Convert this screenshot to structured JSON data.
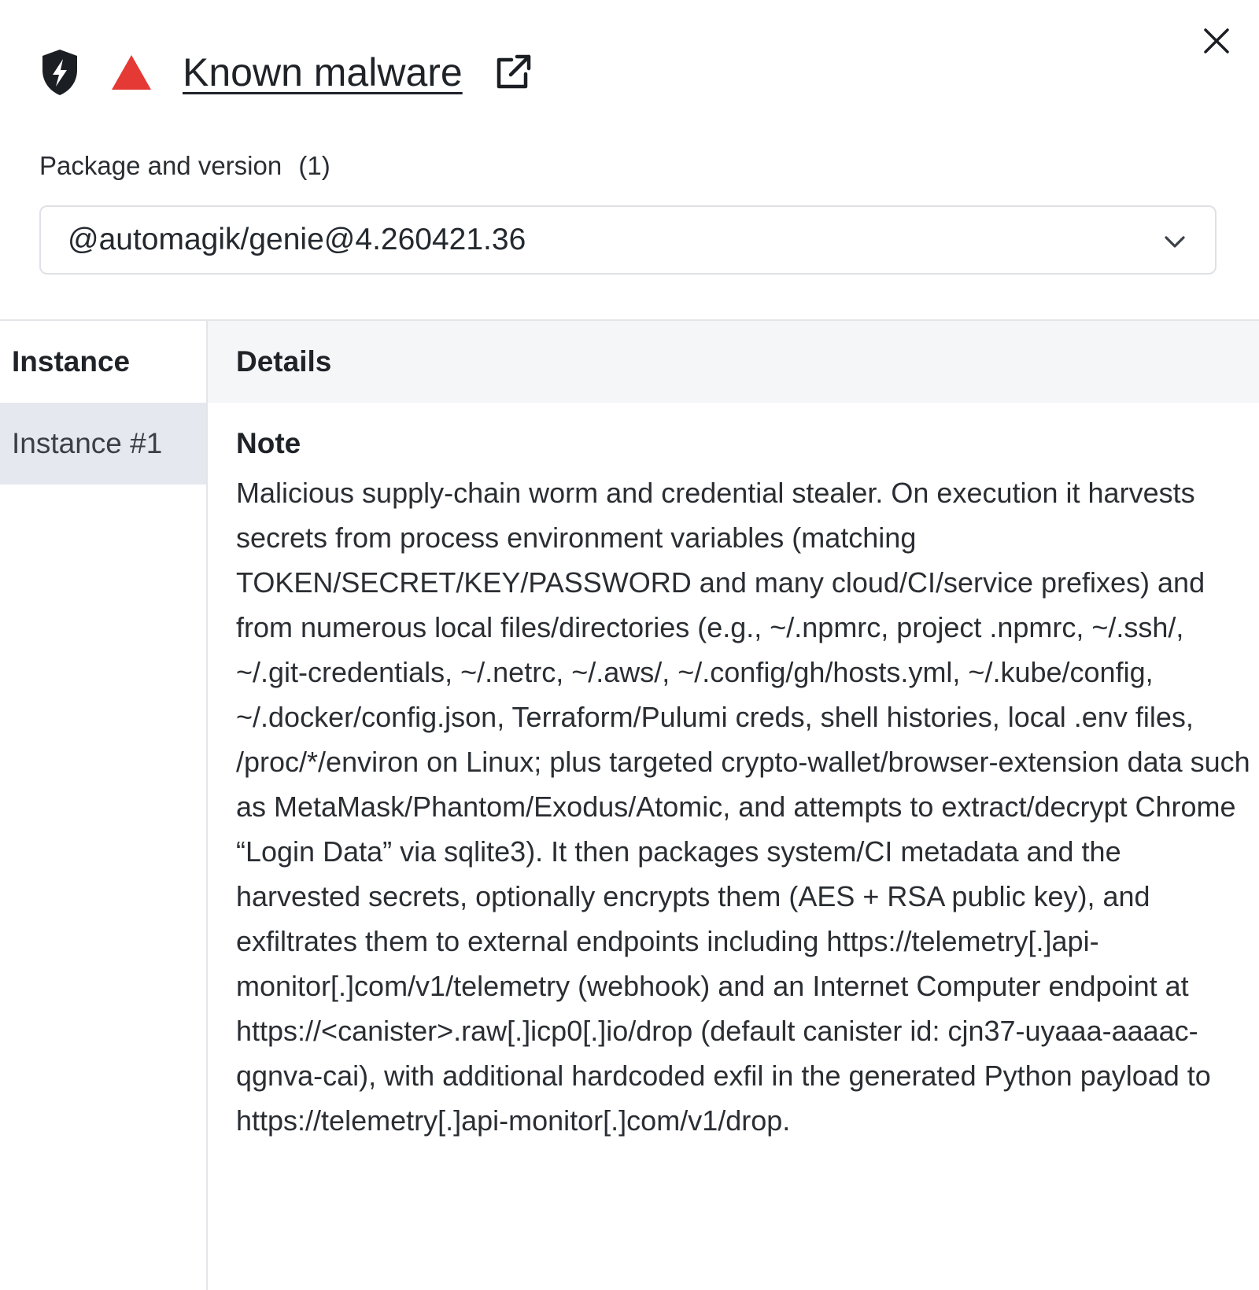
{
  "header": {
    "title": "Known malware",
    "shield_icon": "shield-bolt-icon",
    "severity_icon": "warning-triangle-icon",
    "severity_color": "#e53935",
    "external_icon": "external-link-icon",
    "close_icon": "close-icon"
  },
  "package": {
    "label": "Package and version",
    "count": "(1)",
    "selected": "@automagik/genie@4.260421.36",
    "dropdown_icon": "chevron-down-icon"
  },
  "table": {
    "instance_header": "Instance",
    "details_header": "Details",
    "instances": [
      "Instance #1"
    ],
    "note_title": "Note",
    "note_text": "Malicious supply-chain worm and credential stealer. On execution it harvests secrets from process environment variables (matching TOKEN/SECRET/KEY/PASSWORD and many cloud/CI/service prefixes) and from numerous local files/directories (e.g., ~/.npmrc, project .npmrc, ~/.ssh/, ~/.git-credentials, ~/.netrc, ~/.aws/, ~/.config/gh/hosts.yml, ~/.kube/config, ~/.docker/config.json, Terraform/Pulumi creds, shell histories, local .env files, /proc/*/environ on Linux; plus targeted crypto-wallet/browser-extension data such as MetaMask/Phantom/Exodus/Atomic, and attempts to extract/decrypt Chrome “Login Data” via sqlite3). It then packages system/CI metadata and the harvested secrets, optionally encrypts them (AES + RSA public key), and exfiltrates them to external endpoints including https://telemetry[.]api-monitor[.]com/v1/telemetry (webhook) and an Internet Computer endpoint at https://<canister>.raw[.]icp0[.]io/drop (default canister id: cjn37-uyaaa-aaaac-qgnva-cai), with additional hardcoded exfil in the generated Python payload to https://telemetry[.]api-monitor[.]com/v1/drop."
  }
}
